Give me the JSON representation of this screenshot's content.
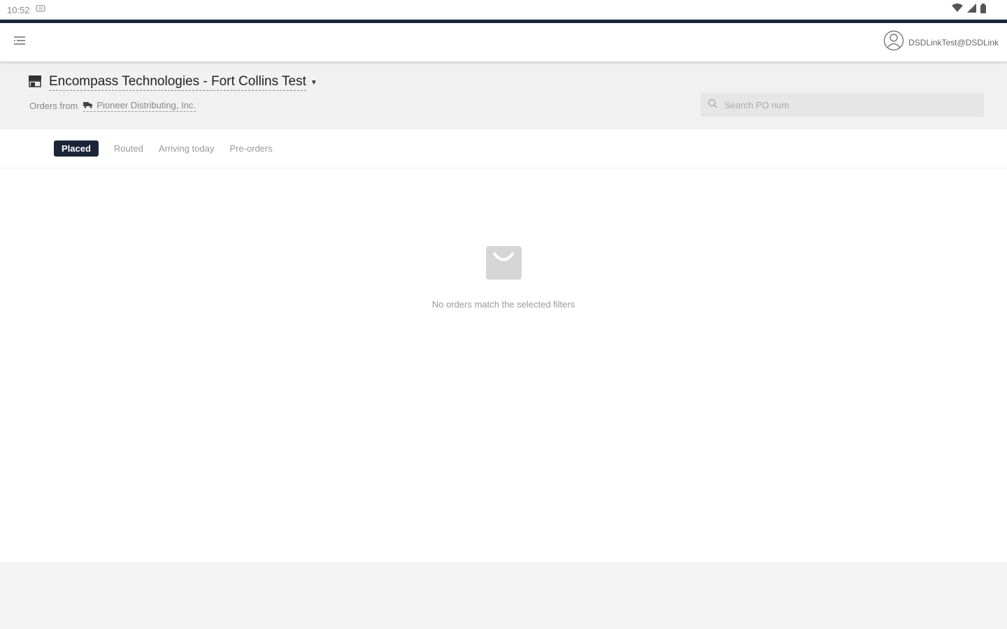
{
  "status_bar": {
    "time": "10:52"
  },
  "app_bar": {
    "account_email": "DSDLinkTest@DSDLink"
  },
  "header": {
    "location_title": "Encompass Technologies - Fort Collins Test",
    "orders_from_label": "Orders from",
    "distributor_name": "Pioneer Distributing, Inc.",
    "search_placeholder": "Search PO num"
  },
  "tabs": [
    {
      "label": "Placed",
      "active": true
    },
    {
      "label": "Routed",
      "active": false
    },
    {
      "label": "Arriving today",
      "active": false
    },
    {
      "label": "Pre-orders",
      "active": false
    }
  ],
  "empty_state": {
    "message": "No orders match the selected filters"
  },
  "colors": {
    "accent": "#1c2438",
    "header_bg": "#f1f1f1",
    "search_bg": "#e6e6e6"
  },
  "icons": {
    "menu": "menu-icon",
    "account": "account-icon",
    "store": "store-icon",
    "truck": "truck-icon",
    "search": "search-icon",
    "empty": "shopping-bag-icon"
  }
}
